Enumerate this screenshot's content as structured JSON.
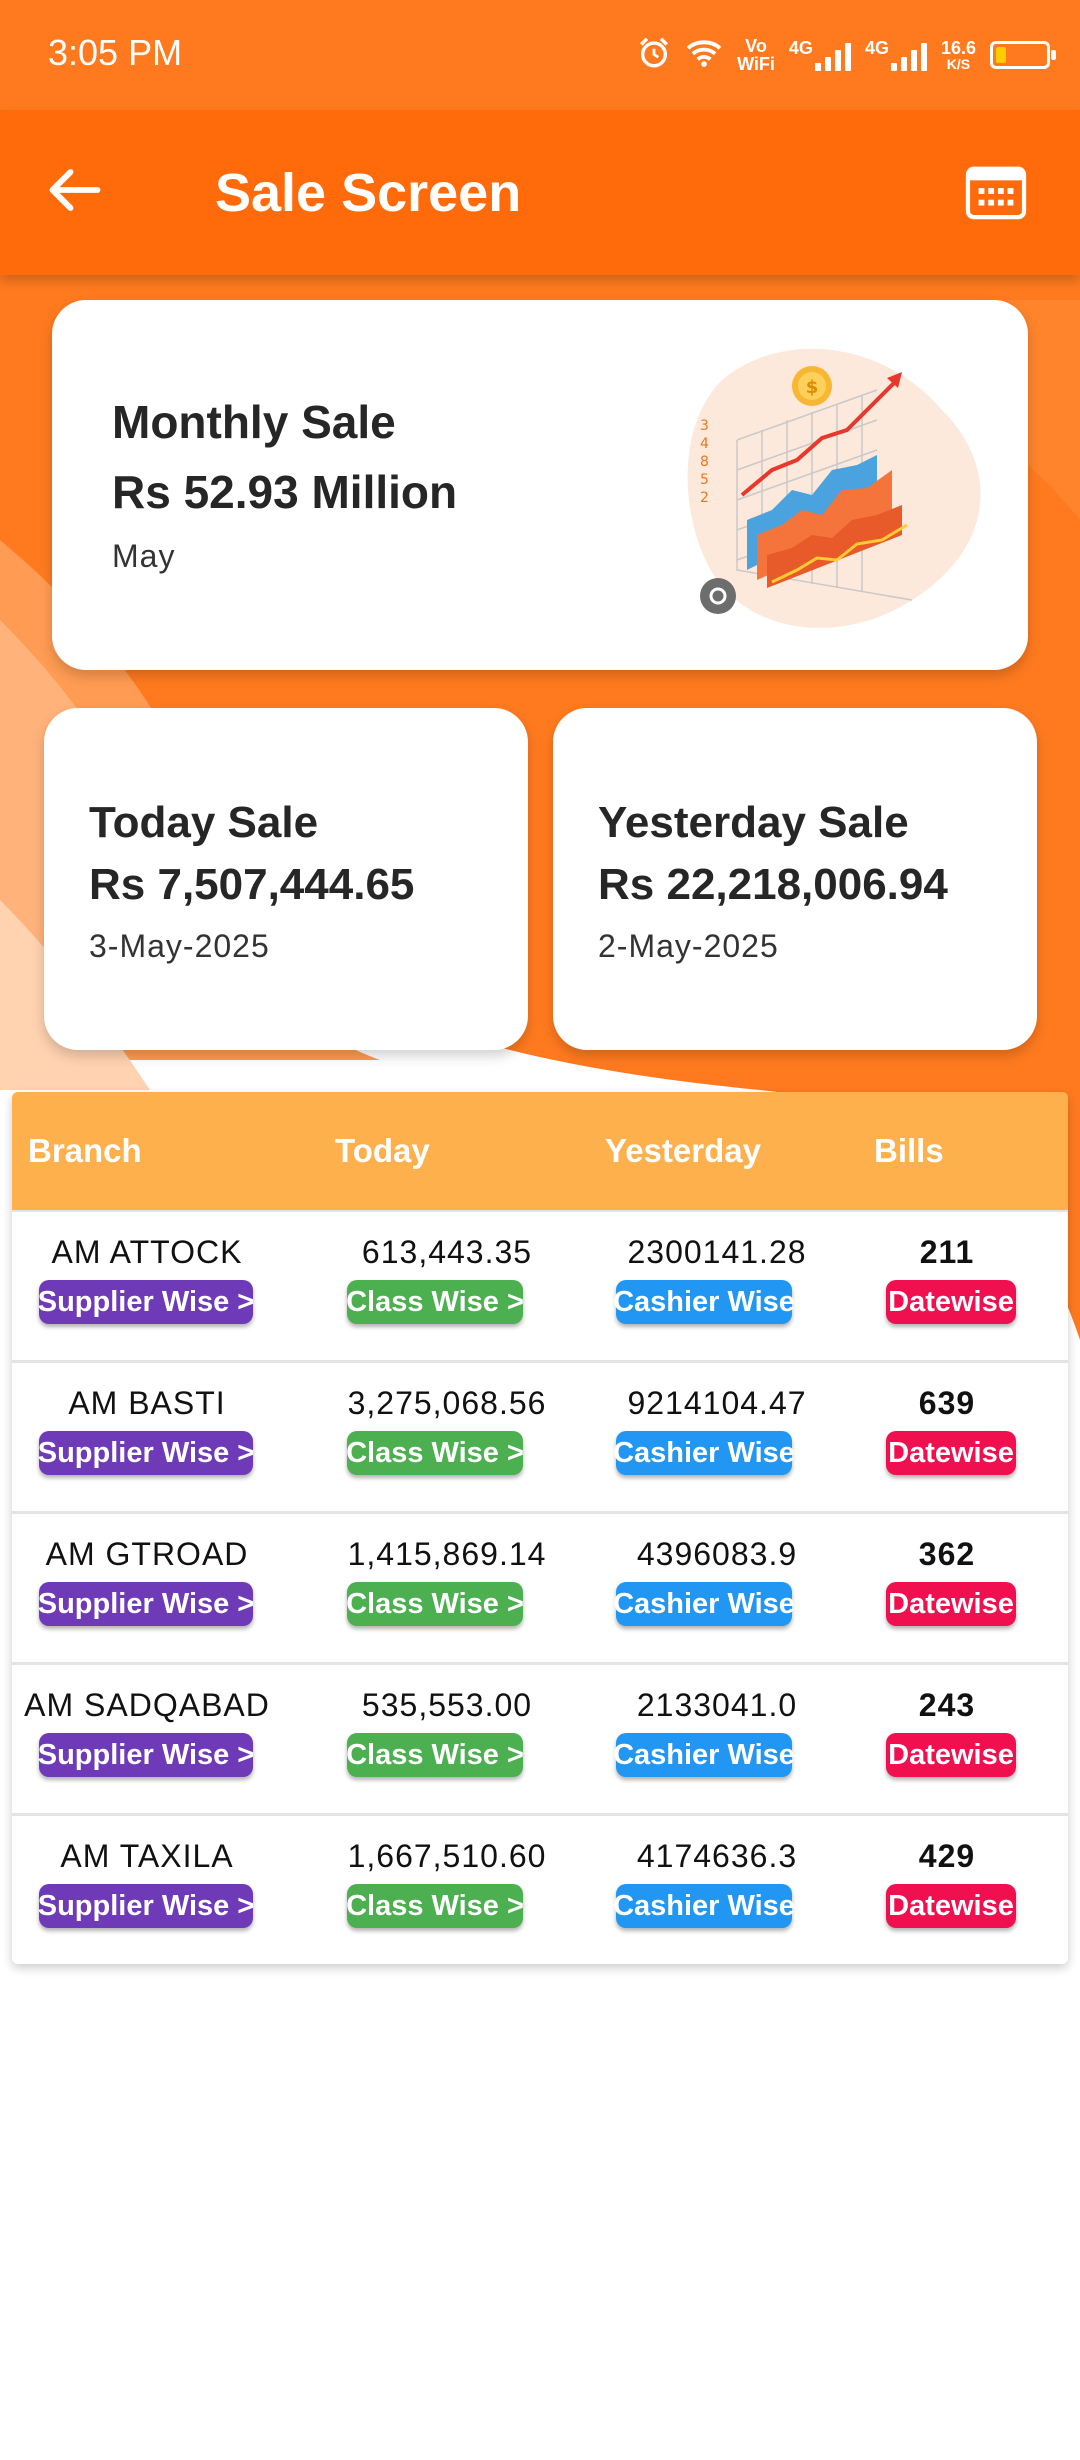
{
  "status_bar": {
    "time": "3:05 PM",
    "icons": [
      "alarm-icon",
      "wifi-icon",
      "vowifi-icon",
      "signal-4g-icon",
      "signal-4g-icon",
      "battery-icon"
    ],
    "vowifi_top": "Vo",
    "vowifi_bottom": "WiFi",
    "network_1": "4G",
    "network_2": "4G",
    "speed_value": "16.6",
    "speed_unit": "K/S"
  },
  "app_bar": {
    "title": "Sale Screen",
    "back_icon": "arrow-left-icon",
    "calendar_icon": "calendar-icon"
  },
  "monthly_card": {
    "label": "Monthly Sale",
    "value": "Rs 52.93 Million",
    "period": "May"
  },
  "today_card": {
    "label": "Today Sale",
    "value": "Rs 7,507,444.65",
    "date": "3-May-2025"
  },
  "yesterday_card": {
    "label": "Yesterday Sale",
    "value": "Rs 22,218,006.94",
    "date": "2-May-2025"
  },
  "table": {
    "headers": {
      "branch": "Branch",
      "today": "Today",
      "yesterday": "Yesterday",
      "bills": "Bills"
    },
    "buttons": {
      "supplier": "Supplier Wise >",
      "class": "Class Wise >",
      "cashier": "Cashier Wise",
      "date": "Datewise"
    },
    "rows": [
      {
        "branch": "AM ATTOCK",
        "today": "613,443.35",
        "yesterday": "2300141.28",
        "bills": "211"
      },
      {
        "branch": "AM BASTI",
        "today": "3,275,068.56",
        "yesterday": "9214104.47",
        "bills": "639"
      },
      {
        "branch": "AM GTROAD",
        "today": "1,415,869.14",
        "yesterday": "4396083.9",
        "bills": "362"
      },
      {
        "branch": "AM SADQABAD",
        "today": "535,553.00",
        "yesterday": "2133041.0",
        "bills": "243"
      },
      {
        "branch": "AM TAXILA",
        "today": "1,667,510.60",
        "yesterday": "4174636.3",
        "bills": "429"
      }
    ]
  },
  "colors": {
    "primary": "#ff6a0a",
    "header_bg": "#fdb04b",
    "supplier_pill": "#6e3ab8",
    "class_pill": "#4caf50",
    "cashier_pill": "#2196f3",
    "date_pill": "#f0104f"
  }
}
